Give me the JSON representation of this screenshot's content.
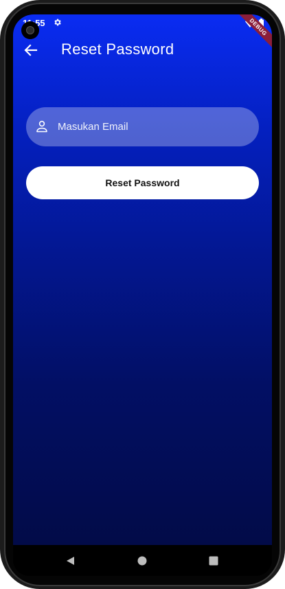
{
  "status_bar": {
    "time": "11:55"
  },
  "debug_banner": "DEBUG",
  "app_bar": {
    "title": "Reset Password",
    "back_icon": "arrow-left-icon"
  },
  "form": {
    "email": {
      "placeholder": "Masukan Email",
      "value": "",
      "icon": "person-icon"
    },
    "submit_label": "Reset Password"
  },
  "nav_bar": {
    "items": [
      "back-triangle-icon",
      "home-circle-icon",
      "recents-square-icon"
    ]
  },
  "colors": {
    "gradient_top": "#0a2cf2",
    "gradient_bottom": "#020b48",
    "button_bg": "#ffffff",
    "field_bg": "rgba(255,255,255,0.30)"
  }
}
